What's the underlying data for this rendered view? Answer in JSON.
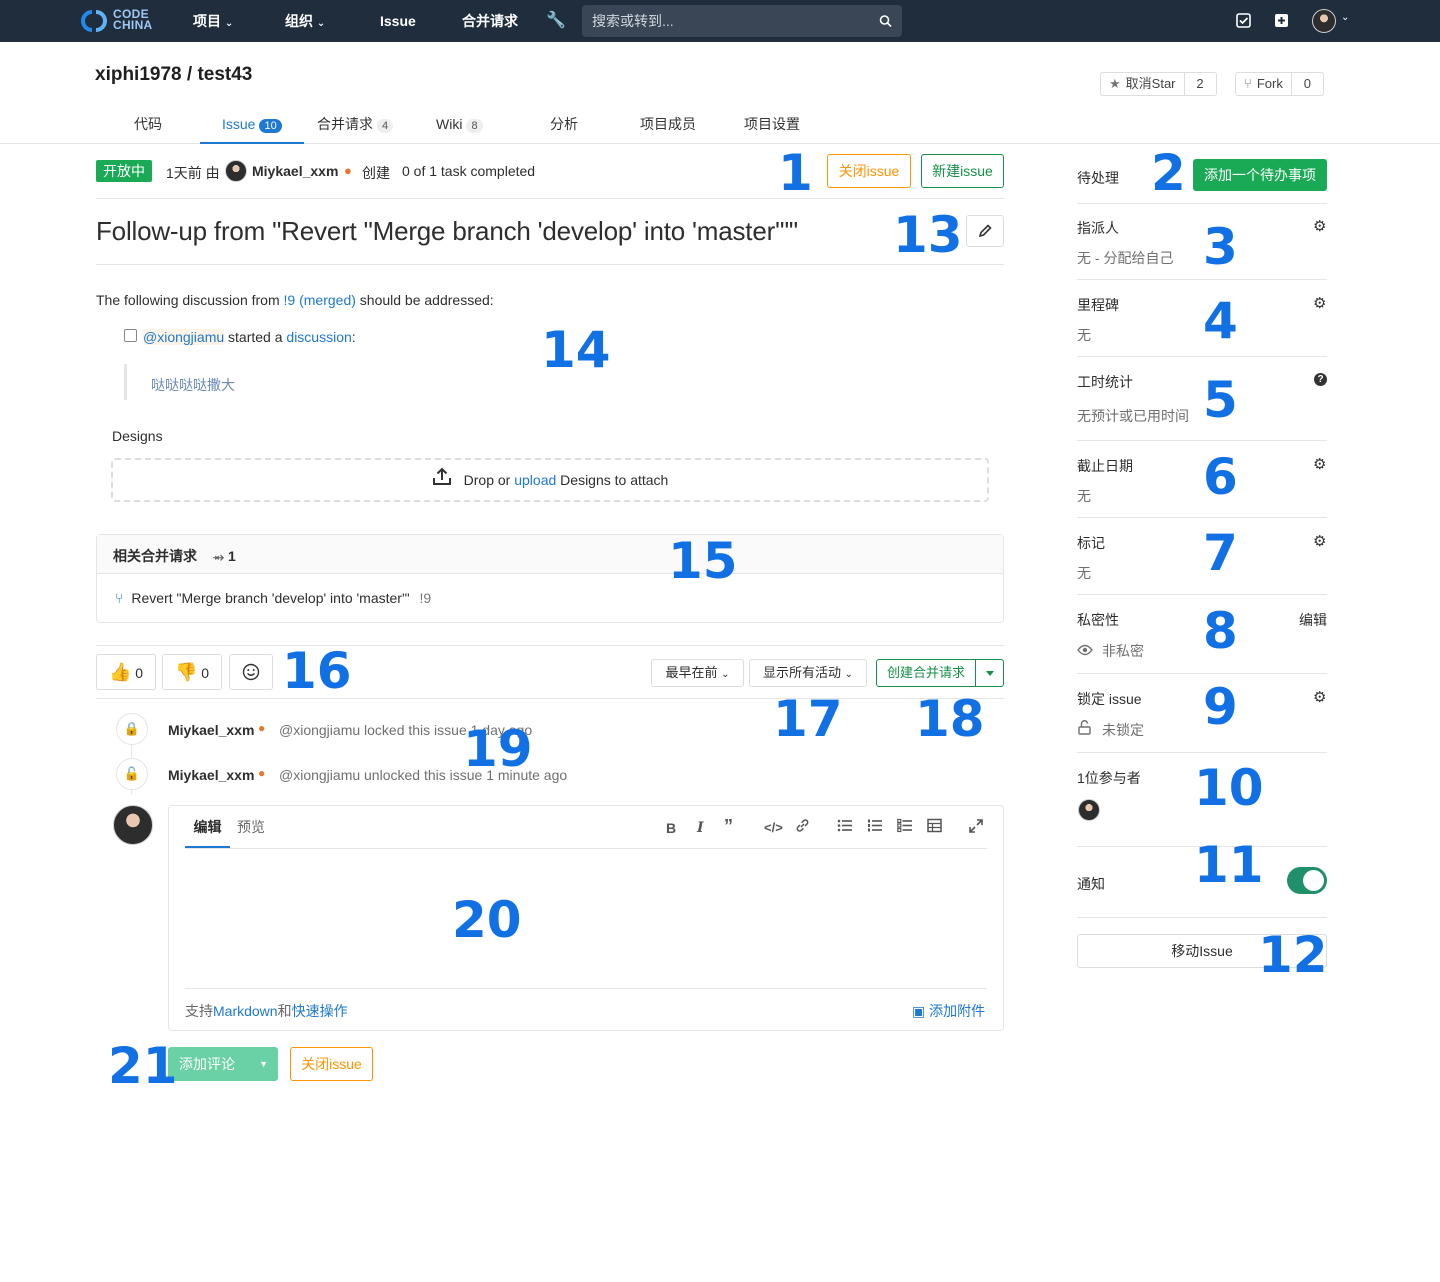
{
  "nav": {
    "logo_line1": "CODE",
    "logo_line2": "CHINA",
    "items": [
      "项目",
      "组织",
      "Issue",
      "合并请求"
    ],
    "search_placeholder": "搜索或转到..."
  },
  "project": {
    "title": "xiphi1978 / test43",
    "star_label": "取消Star",
    "star_count": "2",
    "fork_label": "Fork",
    "fork_count": "0"
  },
  "tabs": [
    {
      "label": "代码",
      "count": ""
    },
    {
      "label": "Issue",
      "count": "10"
    },
    {
      "label": "合并请求",
      "count": "4"
    },
    {
      "label": "Wiki",
      "count": "8"
    },
    {
      "label": "分析",
      "count": ""
    },
    {
      "label": "项目成员",
      "count": ""
    },
    {
      "label": "项目设置",
      "count": ""
    }
  ],
  "issue": {
    "status": "开放中",
    "time_prefix": "1天前 由",
    "author": "Miykael_xxm",
    "created": "创建",
    "tasks": "0 of 1 task completed",
    "close_button": "关闭issue",
    "new_button": "新建issue",
    "title": "Follow-up from \"Revert \"Merge branch 'develop' into 'master'\"\"",
    "desc_prefix": "The following discussion from ",
    "desc_link": "!9 (merged)",
    "desc_suffix": " should be addressed:",
    "mention": "@xiongjiamu",
    "started": " started a ",
    "discussion_link": "discussion",
    "colon": ":",
    "quote": "哒哒哒哒撒大",
    "designs_label": "Designs",
    "drop_prefix": "Drop or ",
    "drop_link": "upload",
    "drop_suffix": " Designs to attach"
  },
  "related": {
    "title": "相关合并请求",
    "count": "1",
    "mr_title": "Revert \"Merge branch 'develop' into 'master'\"",
    "mr_ref": "!9"
  },
  "reactions": {
    "thumbs_up": "0",
    "thumbs_down": "0"
  },
  "activity": {
    "sort": "最早在前",
    "filter": "显示所有活动",
    "create_mr": "创建合并请求",
    "events": [
      {
        "author": "Miykael_xxm",
        "text": "@xiongjiamu locked this issue 1 day ago"
      },
      {
        "author": "Miykael_xxm",
        "text": "@xiongjiamu unlocked this issue 1 minute ago"
      }
    ]
  },
  "editor": {
    "tab_edit": "编辑",
    "tab_preview": "预览",
    "footer_prefix": "支持",
    "footer_markdown": "Markdown",
    "footer_and": "和",
    "footer_quick": "快速操作",
    "attach": "添加附件",
    "comment_button": "添加评论",
    "close_button": "关闭issue"
  },
  "sidebar": {
    "todo_label": "待处理",
    "todo_button": "添加一个待办事项",
    "assignee_title": "指派人",
    "assignee_value": "无 - 分配给自己",
    "milestone_title": "里程碑",
    "milestone_value": "无",
    "time_title": "工时统计",
    "time_value": "无预计或已用时间",
    "due_title": "截止日期",
    "due_value": "无",
    "labels_title": "标记",
    "labels_value": "无",
    "confidential_title": "私密性",
    "confidential_edit": "编辑",
    "confidential_value": "非私密",
    "lock_title": "锁定 issue",
    "lock_value": "未锁定",
    "participants_title": "1位参与者",
    "notify_title": "通知",
    "move_button": "移动Issue"
  },
  "annotations": [
    "1",
    "2",
    "3",
    "4",
    "5",
    "6",
    "7",
    "8",
    "9",
    "10",
    "11",
    "12",
    "13",
    "14",
    "15",
    "16",
    "17",
    "18",
    "19",
    "20",
    "21"
  ],
  "colors": {
    "nav_bg": "#1f2d3d",
    "green": "#1aaa55",
    "orange": "#fc9403",
    "link": "#1f78d1",
    "annotation": "#1170e4"
  }
}
